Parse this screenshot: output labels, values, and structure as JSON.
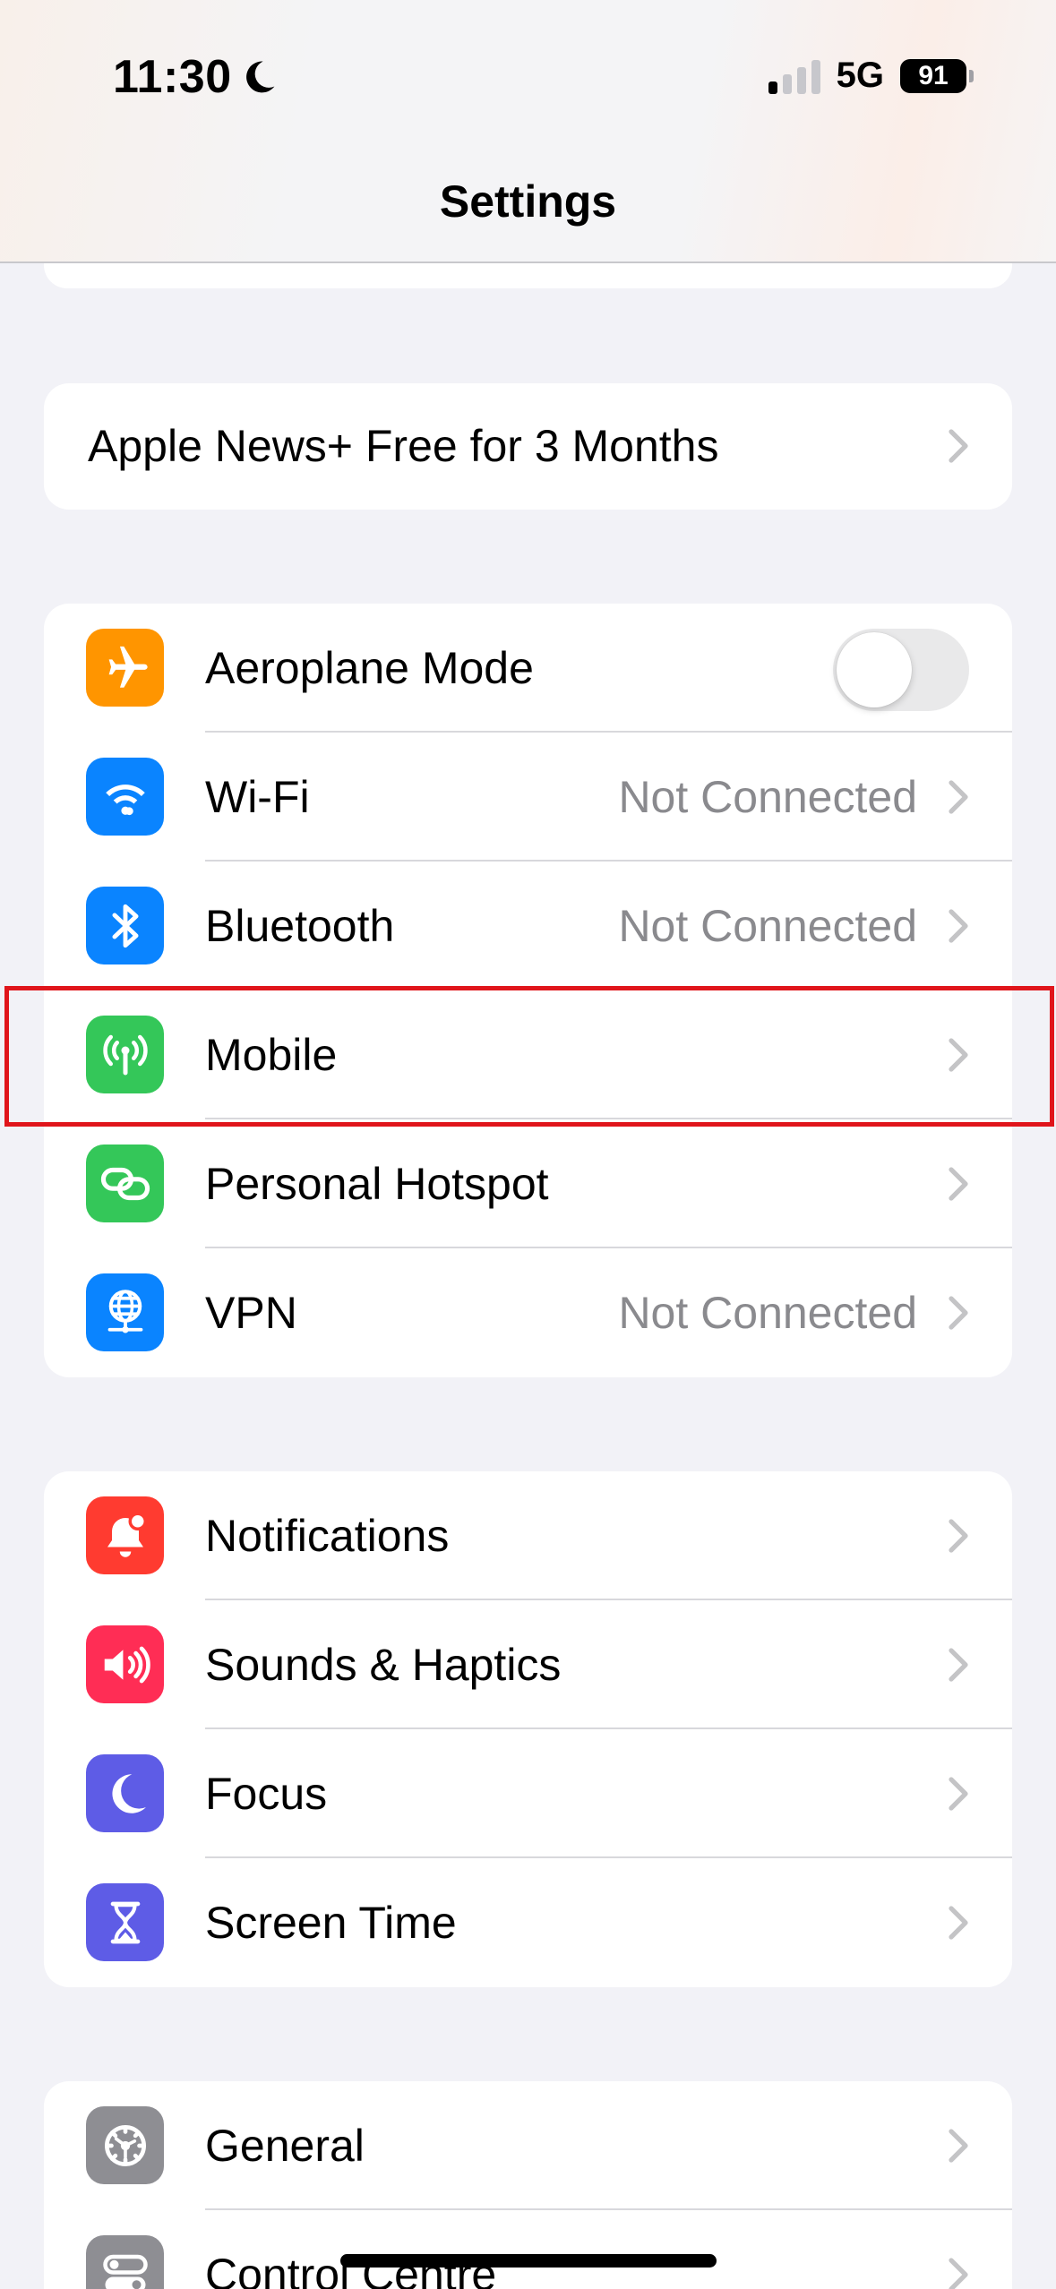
{
  "status_bar": {
    "time": "11:30",
    "network": "5G",
    "battery": "91",
    "signal_bars_active": 1,
    "signal_bars_total": 4
  },
  "header": {
    "title": "Settings"
  },
  "promo": {
    "label": "Apple News+ Free for 3 Months"
  },
  "connectivity": {
    "aeroplane": {
      "label": "Aeroplane Mode",
      "icon": "airplane-icon",
      "color": "#ff9500",
      "toggle_on": false
    },
    "wifi": {
      "label": "Wi-Fi",
      "value": "Not Connected",
      "icon": "wifi-icon",
      "color": "#0a84ff"
    },
    "bluetooth": {
      "label": "Bluetooth",
      "value": "Not Connected",
      "icon": "bluetooth-icon",
      "color": "#0a84ff"
    },
    "mobile": {
      "label": "Mobile",
      "icon": "antenna-icon",
      "color": "#34c759"
    },
    "hotspot": {
      "label": "Personal Hotspot",
      "icon": "link-icon",
      "color": "#34c759"
    },
    "vpn": {
      "label": "VPN",
      "value": "Not Connected",
      "icon": "globe-icon",
      "color": "#0a84ff"
    }
  },
  "alerts": {
    "notifications": {
      "label": "Notifications",
      "icon": "bell-icon",
      "color": "#ff3b30"
    },
    "sounds": {
      "label": "Sounds & Haptics",
      "icon": "speaker-icon",
      "color": "#ff2d55"
    },
    "focus": {
      "label": "Focus",
      "icon": "moon-icon",
      "color": "#5e5ce6"
    },
    "screen_time": {
      "label": "Screen Time",
      "icon": "hourglass-icon",
      "color": "#5e5ce6"
    }
  },
  "system": {
    "general": {
      "label": "General",
      "icon": "gear-icon",
      "color": "#8e8e93"
    },
    "control_centre": {
      "label": "Control Centre",
      "icon": "switches-icon",
      "color": "#8e8e93"
    }
  }
}
